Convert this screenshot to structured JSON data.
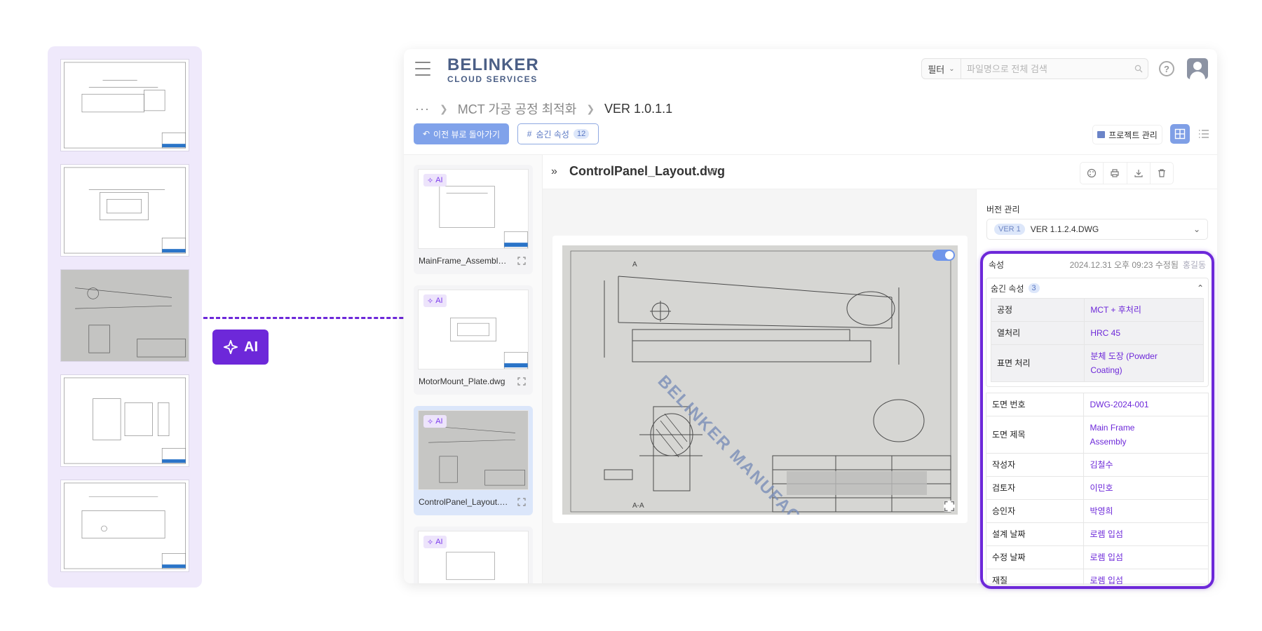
{
  "ai_badge": {
    "label": "AI"
  },
  "app": {
    "logo": {
      "main": "BELINKER",
      "sub": "CLOUD SERVICES"
    },
    "search": {
      "filter_label": "필터",
      "placeholder": "파일명으로 전체 검색"
    },
    "breadcrumb": {
      "ellipsis": "···",
      "project": "MCT 가공 공정 최적화",
      "current": "VER 1.0.1.1"
    },
    "toolbar": {
      "back_label": "이전 뷰로 돌아가기",
      "hidden_attr_label": "숨긴 속성",
      "hidden_attr_count": "12",
      "project_manage_label": "프로젝트 관리"
    },
    "files": [
      {
        "name": "MainFrame_Assembly.dwg",
        "ai": "AI"
      },
      {
        "name": "MotorMount_Plate.dwg",
        "ai": "AI"
      },
      {
        "name": "ControlPanel_Layout.dwg",
        "ai": "AI"
      },
      {
        "name": "",
        "ai": "AI"
      }
    ],
    "viewer": {
      "file_title": "ControlPanel_Layout.dwg",
      "watermark": "BELINKER MANUFACTURING"
    },
    "properties": {
      "version_label": "버전 관리",
      "version_pill": "VER 1",
      "version_value": "VER 1.1.2.4.DWG",
      "section_title": "속성",
      "modified": "2024.12.31 오후 09:23 수정됨",
      "modified_by": "홍길동",
      "hidden_title": "숨긴 속성",
      "hidden_count": "3",
      "hidden_rows": [
        {
          "key": "공정",
          "value": "MCT + 후처리"
        },
        {
          "key": "열처리",
          "value": "HRC 45"
        },
        {
          "key": "표면 처리",
          "value": "분체 도장 (Powder Coating)"
        }
      ],
      "rows": [
        {
          "key": "도면 번호",
          "value": "DWG-2024-001"
        },
        {
          "key": "도면 제목",
          "value": "Main Frame Assembly"
        },
        {
          "key": "작성자",
          "value": "김철수"
        },
        {
          "key": "검토자",
          "value": "이민호"
        },
        {
          "key": "승인자",
          "value": "박영희"
        },
        {
          "key": "설계 날짜",
          "value": "로렘 입섬"
        },
        {
          "key": "수정 날짜",
          "value": "로렘 입섬"
        },
        {
          "key": "재질",
          "value": "로렘 입섬"
        }
      ]
    }
  },
  "colors": {
    "accent": "#6d28d9",
    "primary": "#80a2ea",
    "logo": "#4b5f86"
  }
}
